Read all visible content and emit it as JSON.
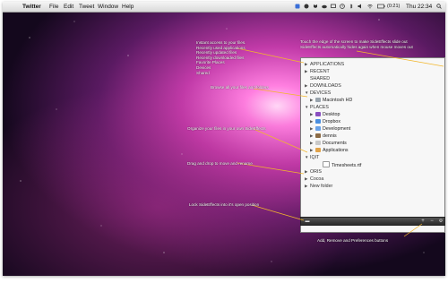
{
  "menubar": {
    "app_name": "Twitter",
    "menus": [
      "File",
      "Edit",
      "Tweet",
      "Window",
      "Help"
    ],
    "battery": "(0:21)",
    "clock": "Thu 22:34"
  },
  "annotations": {
    "top_left": [
      "Instant access to your files.",
      "Recently used applications",
      "Recently updated files",
      "Recently downloaded files",
      "Favorite Places",
      "Devices",
      "Shared"
    ],
    "top_right": [
      "Touch the edge of the screen to make SideEffects slide out",
      "SideEffects automatically hides again when mouse moves out"
    ],
    "devices": "Browse all your files and folders",
    "organize": "Organize your files in your own SideEffects",
    "drag": "Drag and drop to move and rename",
    "lock": "Lock SideEffects into it's open position",
    "buttons": "Add, Remove and Preferences buttons"
  },
  "sidebar": {
    "applications": "APPLICATIONS",
    "recent": "RECENT",
    "shared": "SHARED",
    "downloads": "DOWNLOADS",
    "devices": "DEVICES",
    "macintosh_hd": "Macintosh HD",
    "places": "PLACES",
    "desktop": "Desktop",
    "dropbox": "Dropbox",
    "development": "Development",
    "dennis": "dennis",
    "documents": "Documents",
    "app_folder": "Applications",
    "iqit": "IQIT",
    "timesheets": "Timesheets.rtf",
    "oris": "ORIS",
    "cocoa": "Cocoa",
    "new_folder": "New folder"
  },
  "bottom_buttons": [
    "+",
    "−",
    "⚙"
  ],
  "colors": {
    "wallpaper_glow": "#ff5fd0",
    "wallpaper_dark": "#1a0a22",
    "callout_line": "#f2b62b"
  }
}
